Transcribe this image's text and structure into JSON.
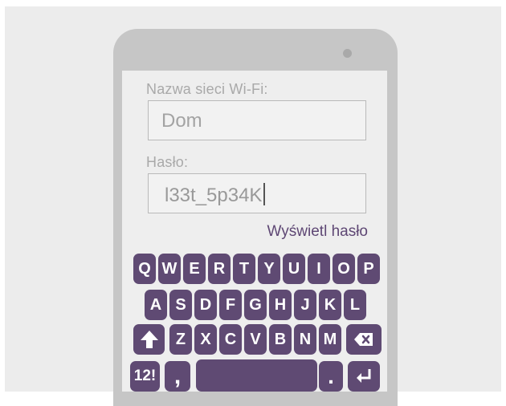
{
  "wifi": {
    "ssid_label": "Nazwa sieci Wi-Fi:",
    "ssid_value": "Dom",
    "password_label": "Hasło:",
    "password_value": "l33t_5p34K",
    "show_password": "Wyświetl hasło"
  },
  "keyboard": {
    "row1": [
      "Q",
      "W",
      "E",
      "R",
      "T",
      "Y",
      "U",
      "I",
      "O",
      "P"
    ],
    "row2": [
      "A",
      "S",
      "D",
      "F",
      "G",
      "H",
      "J",
      "K",
      "L"
    ],
    "row3": [
      "Z",
      "X",
      "C",
      "V",
      "B",
      "N",
      "M"
    ],
    "numbers_key": "12!",
    "comma_key": ",",
    "period_key": ".",
    "shift_icon": "shift-arrow-icon",
    "backspace_icon": "backspace-icon",
    "enter_icon": "enter-return-icon"
  },
  "colors": {
    "key": "#5f4a73",
    "accent_text": "#5e4774"
  }
}
